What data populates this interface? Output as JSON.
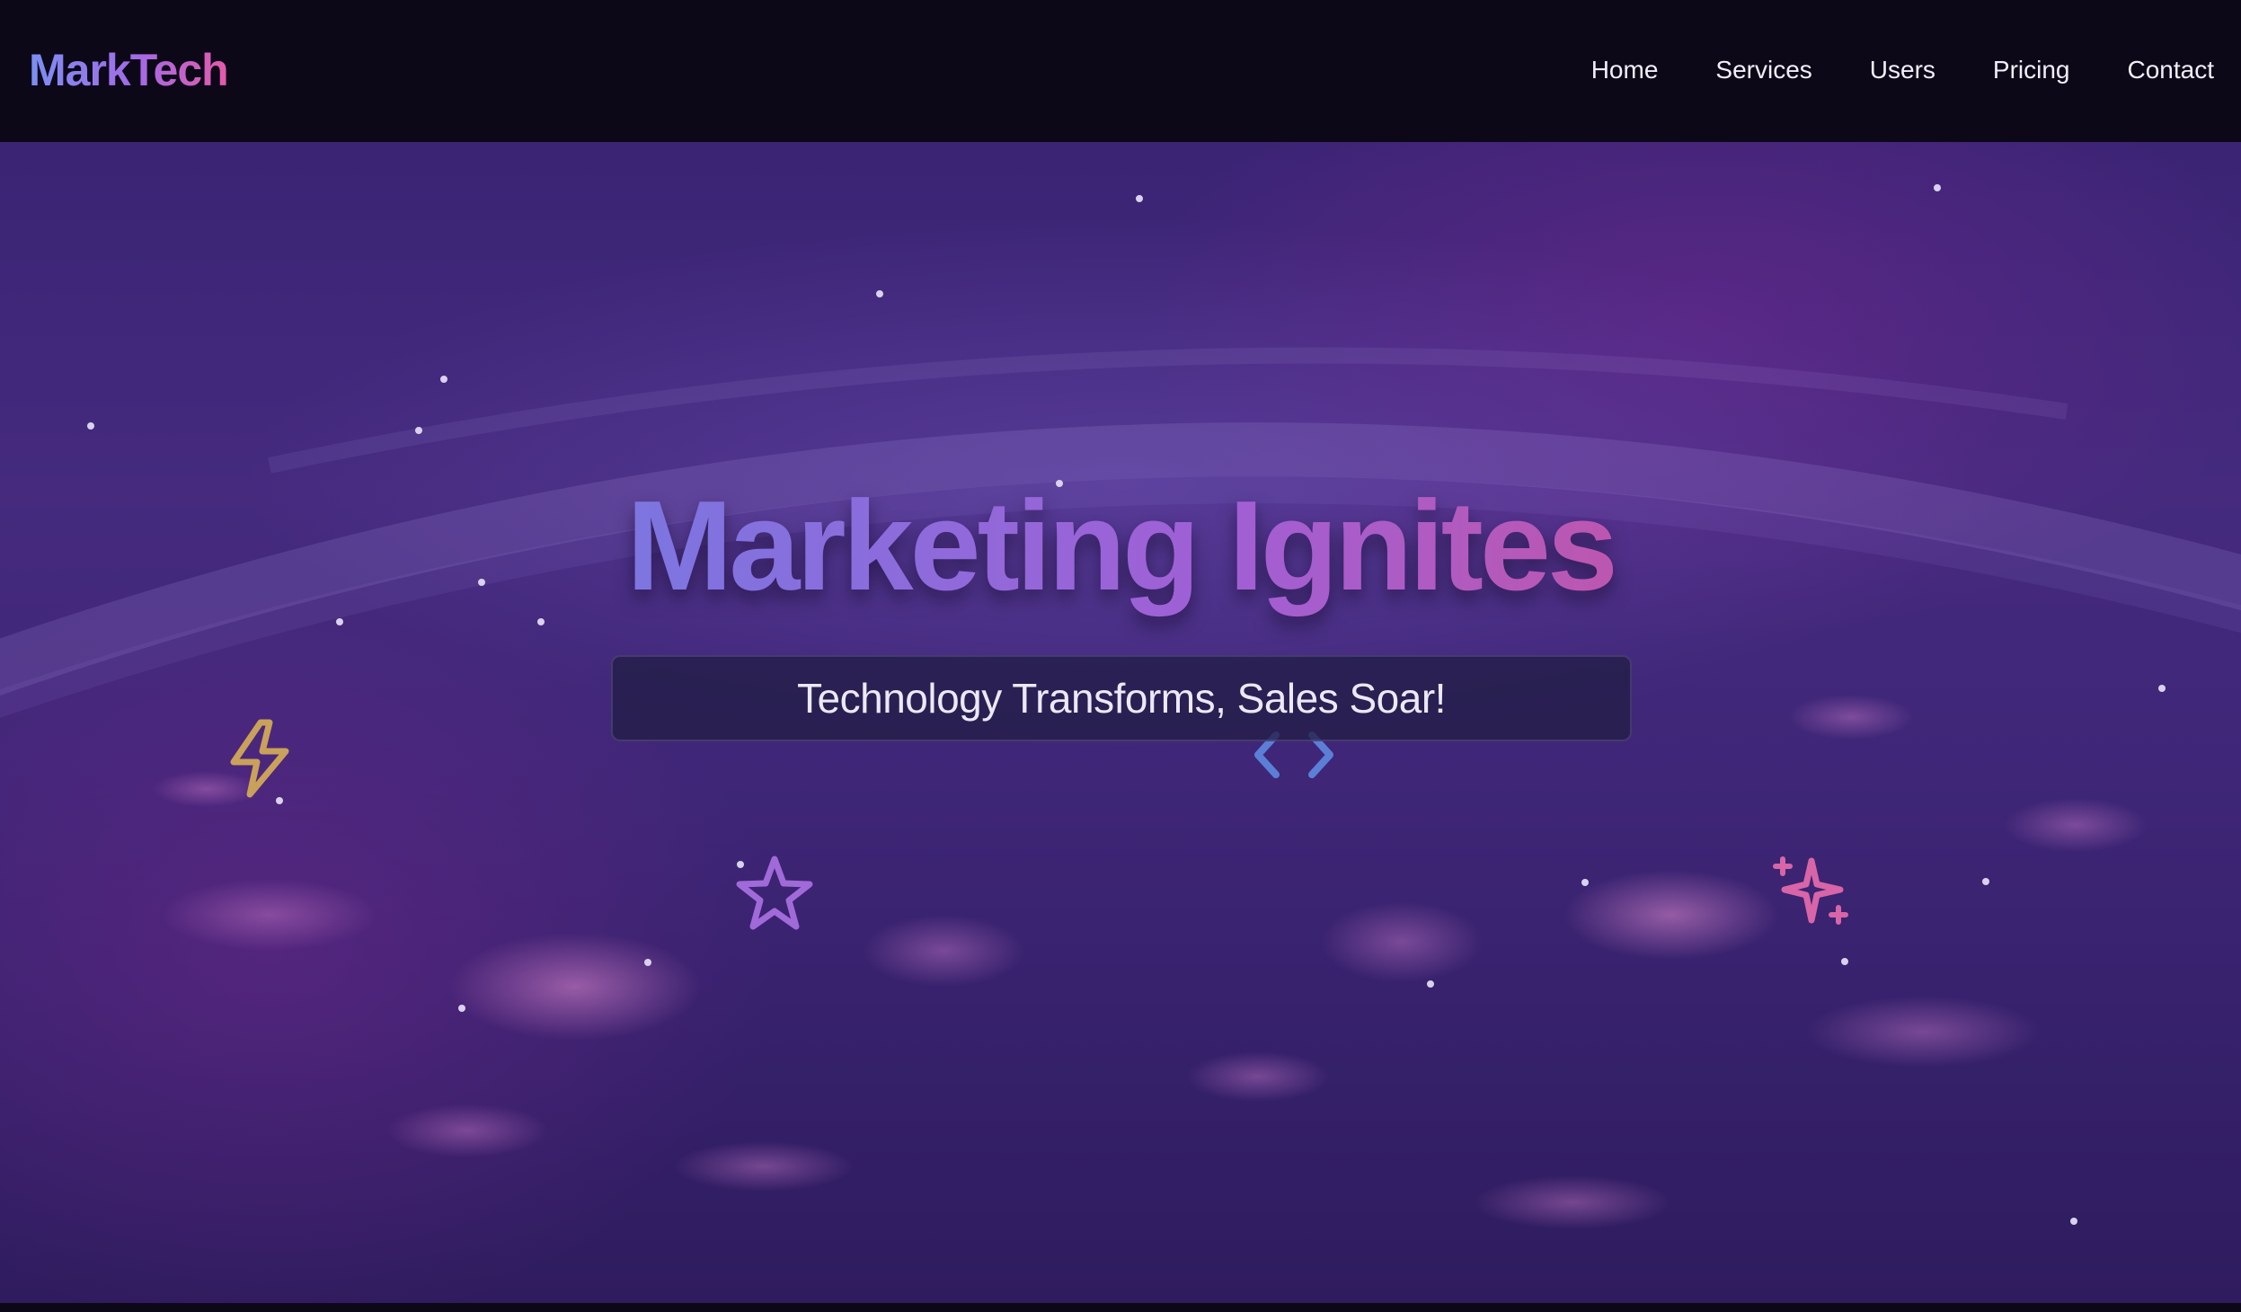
{
  "brand": {
    "logo_text": "MarkTech"
  },
  "nav": {
    "items": [
      {
        "label": "Home"
      },
      {
        "label": "Services"
      },
      {
        "label": "Users"
      },
      {
        "label": "Pricing"
      },
      {
        "label": "Contact"
      }
    ]
  },
  "hero": {
    "title": "Marketing Ignites",
    "subtitle": "Technology Transforms, Sales Soar!"
  },
  "icons": {
    "lightning": "lightning-icon",
    "code": "code-brackets-icon",
    "star": "star-icon",
    "sparkles": "sparkles-icon"
  },
  "colors": {
    "lightning": "#c9a15a",
    "code": "#5b7fd6",
    "star": "#a06ad8",
    "sparkles": "#d865a8",
    "logo_gradient_start": "#7b8ff2",
    "logo_gradient_end": "#e45aa8"
  }
}
